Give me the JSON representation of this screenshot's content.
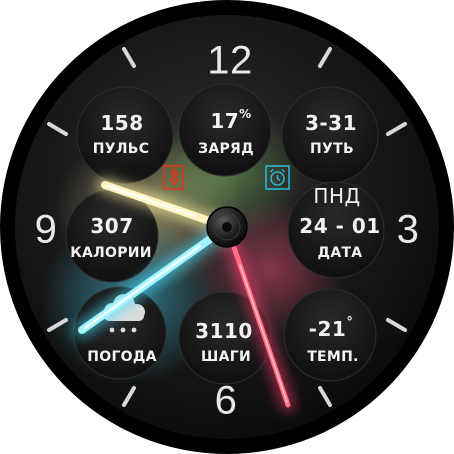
{
  "dial": {
    "numerals": {
      "twelve": "12",
      "three": "3",
      "six": "6",
      "nine": "9"
    }
  },
  "complications": {
    "pulse": {
      "value": "158",
      "label": "ПУЛЬС"
    },
    "battery": {
      "value": "17",
      "unit": "%",
      "label": "ЗАРЯД"
    },
    "distance": {
      "value": "3-31",
      "label": "ПУТЬ"
    },
    "calories": {
      "value": "307",
      "label": "КАЛОРИИ"
    },
    "date": {
      "weekday": "ПНД",
      "value": "24 - 01",
      "label": "ДАТА"
    },
    "weather": {
      "label": "ПОГОДА",
      "icon": "cloud-rain-icon"
    },
    "steps": {
      "value": "3110",
      "label": "ШАГИ"
    },
    "temperature": {
      "value": "-21",
      "unit": "°",
      "label": "ТЕМП."
    }
  },
  "status_icons": {
    "bluetooth": {
      "icon": "bluetooth-icon",
      "color": "#e0341c"
    },
    "alarm": {
      "icon": "alarm-clock-icon",
      "color": "#2fb3d8"
    }
  },
  "hands": {
    "hour_color": "#fff3c0",
    "minute_color": "#9ff4ff",
    "second_color": "#ff6f86"
  },
  "colors": {
    "bezel": "#000000",
    "face": "#1b1b1b",
    "text": "#f2f2f2"
  }
}
